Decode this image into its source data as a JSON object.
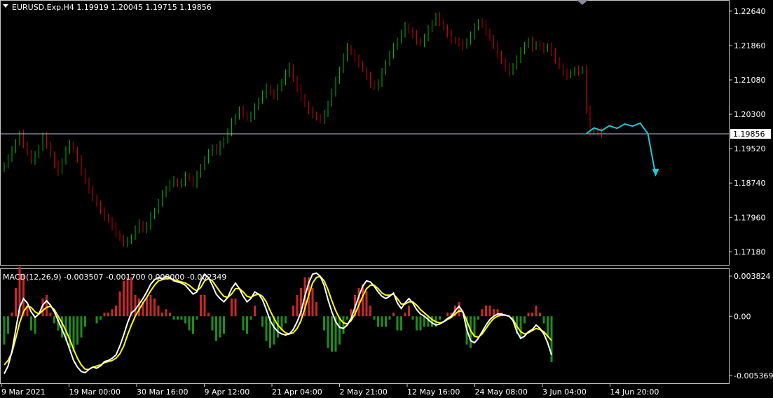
{
  "colors": {
    "background": "#000000",
    "frame": "#c8c8c8",
    "bull_candle": "#00b300",
    "bear_candle": "#cc0000",
    "current_price_line": "#b4c8dc",
    "projection": "#20c8d8",
    "macd_main": "#ffffff",
    "macd_signal": "#ffff00",
    "hist_positive": "#c82828",
    "hist_negative": "#1e8c1e"
  },
  "chart_data": [
    {
      "type": "candlestick",
      "title": "EURUSD.Exp,H4  1.19919 1.20045 1.19715 1.19856",
      "symbol": "EURUSD.Exp",
      "timeframe": "H4",
      "ohlc_last": {
        "open": 1.19919,
        "high": 1.20045,
        "low": 1.19715,
        "close": 1.19856
      },
      "current_price": 1.19856,
      "current_price_label": "1.19856",
      "ylim": [
        1.169,
        1.2286
      ],
      "yticks": [
        "1.22640",
        "1.21860",
        "1.21080",
        "1.20300",
        "1.19520",
        "1.18740",
        "1.17960",
        "1.17180"
      ],
      "xticks": [
        "9 Mar 2021",
        "19 Mar 00:00",
        "30 Mar 16:00",
        "9 Apr 12:00",
        "21 Apr 04:00",
        "2 May 21:00",
        "12 May 16:00",
        "24 May 08:00",
        "3 Jun 04:00",
        "14 Jun 20:00"
      ],
      "closes": [
        1.1915,
        1.1932,
        1.1948,
        1.1968,
        1.1985,
        1.1963,
        1.1941,
        1.1925,
        1.1936,
        1.1955,
        1.198,
        1.1962,
        1.1938,
        1.1915,
        1.19,
        1.1924,
        1.195,
        1.1962,
        1.1948,
        1.1928,
        1.1901,
        1.1878,
        1.1858,
        1.1842,
        1.1826,
        1.181,
        1.1798,
        1.1789,
        1.1775,
        1.176,
        1.1748,
        1.1738,
        1.1742,
        1.1752,
        1.177,
        1.1782,
        1.1768,
        1.1778,
        1.1798,
        1.1812,
        1.183,
        1.1848,
        1.1862,
        1.1874,
        1.188,
        1.1871,
        1.1876,
        1.189,
        1.1884,
        1.1873,
        1.1892,
        1.1911,
        1.1928,
        1.1941,
        1.1955,
        1.1946,
        1.196,
        1.1972,
        1.199,
        1.2012,
        1.2026,
        1.204,
        1.2032,
        1.202,
        1.2028,
        1.2045,
        1.2062,
        1.2076,
        1.209,
        1.208,
        1.2072,
        1.2088,
        1.2104,
        1.2124,
        1.2137,
        1.211,
        1.2088,
        1.207,
        1.2052,
        1.2038,
        1.203,
        1.2022,
        1.2018,
        1.203,
        1.2055,
        1.208,
        1.2105,
        1.2132,
        1.216,
        1.2182,
        1.217,
        1.2156,
        1.2145,
        1.2131,
        1.2116,
        1.21,
        1.2092,
        1.2102,
        1.2125,
        1.2148,
        1.2166,
        1.2182,
        1.2198,
        1.2214,
        1.223,
        1.222,
        1.2211,
        1.2198,
        1.219,
        1.2205,
        1.2222,
        1.2238,
        1.2252,
        1.224,
        1.2226,
        1.2212,
        1.22,
        1.2196,
        1.2191,
        1.2185,
        1.2196,
        1.221,
        1.2226,
        1.224,
        1.2234,
        1.2218,
        1.2202,
        1.2186,
        1.2168,
        1.215,
        1.2136,
        1.2125,
        1.214,
        1.2156,
        1.2172,
        1.2188,
        1.2196,
        1.2182,
        1.219,
        1.2183,
        1.2178,
        1.2185,
        1.217,
        1.2154,
        1.2138,
        1.2124,
        1.2118,
        1.2125,
        1.2131,
        1.2127,
        1.2133,
        1.204,
        1.1989,
        1.1992,
        1.199,
        1.1986
      ],
      "projection_zigzag": [
        [
          151,
          1.1986
        ],
        [
          153,
          1.1999
        ],
        [
          155,
          1.1993
        ],
        [
          157,
          1.2004
        ],
        [
          159,
          1.1998
        ],
        [
          161,
          1.2008
        ],
        [
          163,
          1.2003
        ],
        [
          165,
          1.201
        ],
        [
          167,
          1.1986
        ],
        [
          169,
          1.1892
        ]
      ],
      "series": []
    },
    {
      "type": "macd",
      "title": "MACD(12,26,9) -0.003507 -0.001700 0.000000 -0.002349",
      "params": [
        12,
        26,
        9
      ],
      "ylim": [
        -0.006,
        0.0042
      ],
      "yticks": [
        "0.003824",
        "0.00",
        "-0.005369"
      ],
      "macd": [
        -0.0052,
        -0.0045,
        -0.0032,
        -0.0012,
        0.0008,
        0.0016,
        0.0012,
        0.0004,
        -0.0001,
        0.0002,
        0.001,
        0.0014,
        0.001,
        0.0004,
        -0.0004,
        -0.0012,
        -0.002,
        -0.003,
        -0.004,
        -0.0046,
        -0.005,
        -0.0051,
        -0.0048,
        -0.0046,
        -0.0047,
        -0.0045,
        -0.0041,
        -0.004,
        -0.0038,
        -0.0035,
        -0.0027,
        -0.0017,
        -0.0006,
        0.0003,
        0.0006,
        0.0011,
        0.0016,
        0.0022,
        0.0029,
        0.0033,
        0.0035,
        0.0034,
        0.0036,
        0.0035,
        0.0032,
        0.0031,
        0.003,
        0.0028,
        0.0024,
        0.002,
        0.0022,
        0.0032,
        0.0038,
        0.0035,
        0.0028,
        0.002,
        0.0016,
        0.0013,
        0.0017,
        0.0025,
        0.003,
        0.0025,
        0.0018,
        0.0013,
        0.0016,
        0.0022,
        0.002,
        0.0015,
        0.0006,
        -0.0004,
        -0.001,
        -0.0014,
        -0.0016,
        -0.0017,
        -0.0016,
        -0.0012,
        -0.0005,
        0.0004,
        0.0018,
        0.003,
        0.0038,
        0.0039,
        0.0036,
        0.0028,
        0.0015,
        0.0004,
        -0.0005,
        -0.001,
        -0.0011,
        -0.0008,
        -0.0002,
        0.0008,
        0.0018,
        0.0027,
        0.0032,
        0.0031,
        0.0027,
        0.0022,
        0.0018,
        0.0016,
        0.0018,
        0.0021,
        0.0012,
        0.0007,
        0.0012,
        0.0016,
        0.0012,
        0.0006,
        0.0002,
        0.0,
        -0.0003,
        -0.0006,
        -0.0008,
        -0.0007,
        -0.0005,
        -0.0002,
        0.0,
        0.0005,
        0.0009,
        0.0004,
        -0.0012,
        -0.0022,
        -0.0024,
        -0.002,
        -0.0014,
        -0.0008,
        -0.0003,
        0.0,
        0.0002,
        0.0002,
        0.0001,
        0.0,
        -0.0004,
        -0.0014,
        -0.002,
        -0.0018,
        -0.0014,
        -0.0012,
        -0.0008,
        -0.0011,
        -0.0016,
        -0.0024,
        -0.0035
      ],
      "signal": [
        -0.0044,
        -0.004,
        -0.0033,
        -0.002,
        -0.0006,
        0.0004,
        0.0009,
        0.0008,
        0.0004,
        0.0002,
        0.0005,
        0.0008,
        0.0009,
        0.0006,
        0.0,
        -0.0006,
        -0.0013,
        -0.0021,
        -0.003,
        -0.0038,
        -0.0044,
        -0.0048,
        -0.0048,
        -0.0046,
        -0.0045,
        -0.0044,
        -0.0042,
        -0.0041,
        -0.004,
        -0.0038,
        -0.0034,
        -0.0027,
        -0.0017,
        -0.0008,
        0.0,
        0.0006,
        0.0012,
        0.0017,
        0.0023,
        0.0028,
        0.0032,
        0.0033,
        0.0034,
        0.0034,
        0.0033,
        0.0032,
        0.0031,
        0.003,
        0.0028,
        0.0025,
        0.0023,
        0.0026,
        0.0032,
        0.0034,
        0.0032,
        0.0027,
        0.0022,
        0.0018,
        0.0017,
        0.002,
        0.0025,
        0.0025,
        0.0022,
        0.0018,
        0.0017,
        0.0019,
        0.002,
        0.0018,
        0.0013,
        0.0005,
        -0.0002,
        -0.0008,
        -0.0012,
        -0.0015,
        -0.0016,
        -0.0015,
        -0.0011,
        -0.0004,
        0.0007,
        0.0019,
        0.003,
        0.0035,
        0.0036,
        0.0032,
        0.0024,
        0.0014,
        0.0005,
        -0.0002,
        -0.0006,
        -0.0007,
        -0.0004,
        0.0002,
        0.001,
        0.0018,
        0.0025,
        0.0028,
        0.0028,
        0.0025,
        0.0021,
        0.0019,
        0.0019,
        0.002,
        0.0016,
        0.0011,
        0.0011,
        0.0013,
        0.0013,
        0.001,
        0.0006,
        0.0003,
        0.0,
        -0.0003,
        -0.0005,
        -0.0006,
        -0.0005,
        -0.0003,
        -0.0001,
        0.0002,
        0.0005,
        0.0004,
        -0.0004,
        -0.0013,
        -0.0018,
        -0.0019,
        -0.0016,
        -0.0011,
        -0.0006,
        -0.0002,
        0.0,
        0.0001,
        0.0001,
        0.0,
        -0.0003,
        -0.0009,
        -0.0014,
        -0.0016,
        -0.0015,
        -0.0013,
        -0.0011,
        -0.0012,
        -0.0014,
        -0.0018,
        -0.0022
      ]
    }
  ]
}
